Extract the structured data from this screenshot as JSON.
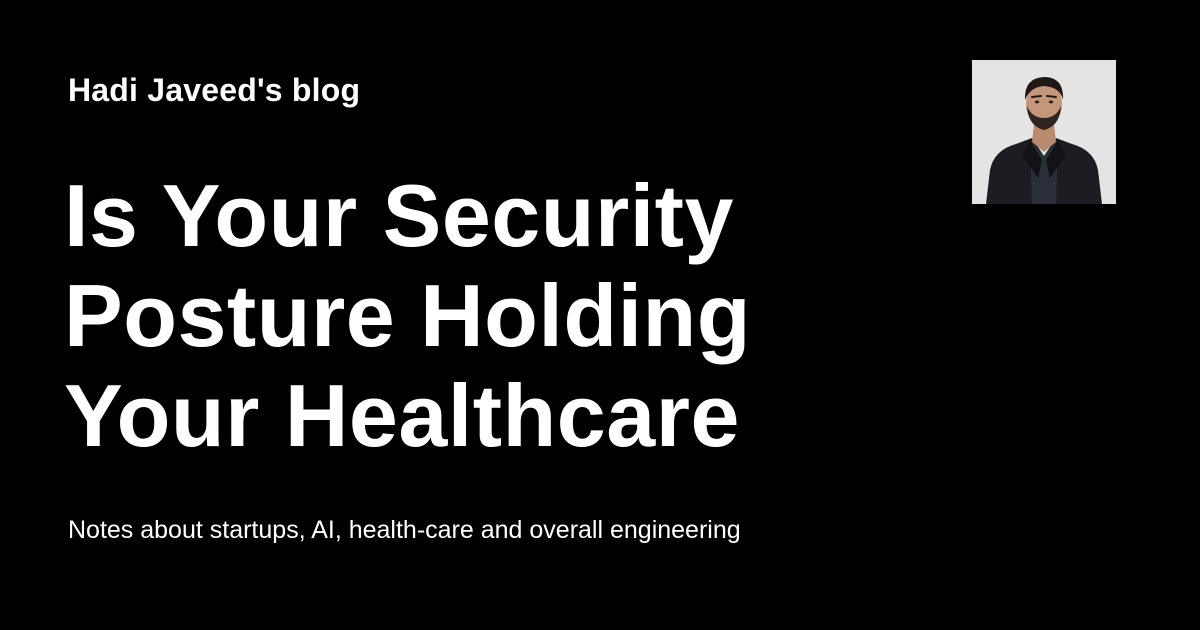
{
  "blog_name": "Hadi Javeed's blog",
  "post_title_lines": [
    "Is Your Security",
    "Posture Holding",
    "Your Healthcare"
  ],
  "tagline": "Notes about startups, AI, health-care and overall engineering",
  "avatar": {
    "icon": "person-portrait",
    "background": "#e6e6e6"
  },
  "colors": {
    "background": "#000000",
    "text": "#ffffff"
  }
}
